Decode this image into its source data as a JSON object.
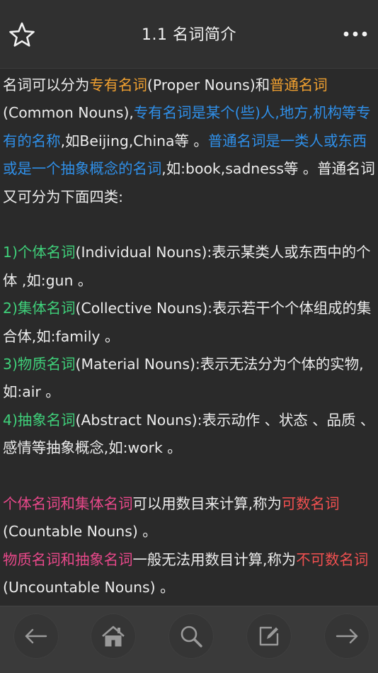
{
  "header": {
    "title": "1.1 名词简介"
  },
  "content": {
    "para1": [
      {
        "t": "名词可以分为",
        "c": ""
      },
      {
        "t": "专有名词",
        "c": "orange"
      },
      {
        "t": "(Proper Nouns)和",
        "c": ""
      },
      {
        "t": "普通名词",
        "c": "orange"
      },
      {
        "t": "(Common Nouns),",
        "c": ""
      },
      {
        "t": "专有名词是某个(些)人,地方,机构等专有的名称",
        "c": "blue"
      },
      {
        "t": ",如Beijing,China等 。",
        "c": ""
      },
      {
        "t": "普通名词是一类人或东西或是一个抽象概念的名词",
        "c": "blue"
      },
      {
        "t": ",如:book,sadness等 。普通名词又可分为下面四类:",
        "c": ""
      }
    ],
    "item1": [
      {
        "t": "1)个体名词",
        "c": "green"
      },
      {
        "t": "(Individual Nouns):表示某类人或东西中的个体 ,如:gun 。",
        "c": ""
      }
    ],
    "item2": [
      {
        "t": "2)集体名词",
        "c": "green"
      },
      {
        "t": "(Collective Nouns):表示若干个个体组成的集合体,如:family 。",
        "c": ""
      }
    ],
    "item3": [
      {
        "t": "3)物质名词",
        "c": "green"
      },
      {
        "t": "(Material Nouns):表示无法分为个体的实物,如:air 。",
        "c": ""
      }
    ],
    "item4": [
      {
        "t": "4)抽象名词",
        "c": "green"
      },
      {
        "t": "(Abstract Nouns):表示动作 、状态 、品质 、感情等抽象概念,如:work 。",
        "c": ""
      }
    ],
    "para3": [
      {
        "t": "个体名词和集体名词",
        "c": "pink"
      },
      {
        "t": "可以用数目来计算,称为",
        "c": ""
      },
      {
        "t": "可数名词",
        "c": "red"
      },
      {
        "t": "(Countable Nouns) 。",
        "c": ""
      }
    ],
    "para4": [
      {
        "t": "物质名词和抽象名词",
        "c": "pink"
      },
      {
        "t": "一般无法用数目计算,称为",
        "c": ""
      },
      {
        "t": "不可数名词",
        "c": "red"
      },
      {
        "t": "(Uncountable Nouns) 。",
        "c": ""
      }
    ]
  },
  "toolbar": {
    "buttons": [
      "back-arrow-icon",
      "home-icon",
      "search-icon",
      "edit-icon",
      "forward-arrow-icon"
    ]
  },
  "colors": {
    "orange": "#f0a030",
    "blue": "#2f8fe8",
    "green": "#3fd07a",
    "pink": "#e8488a",
    "red": "#f05050"
  }
}
